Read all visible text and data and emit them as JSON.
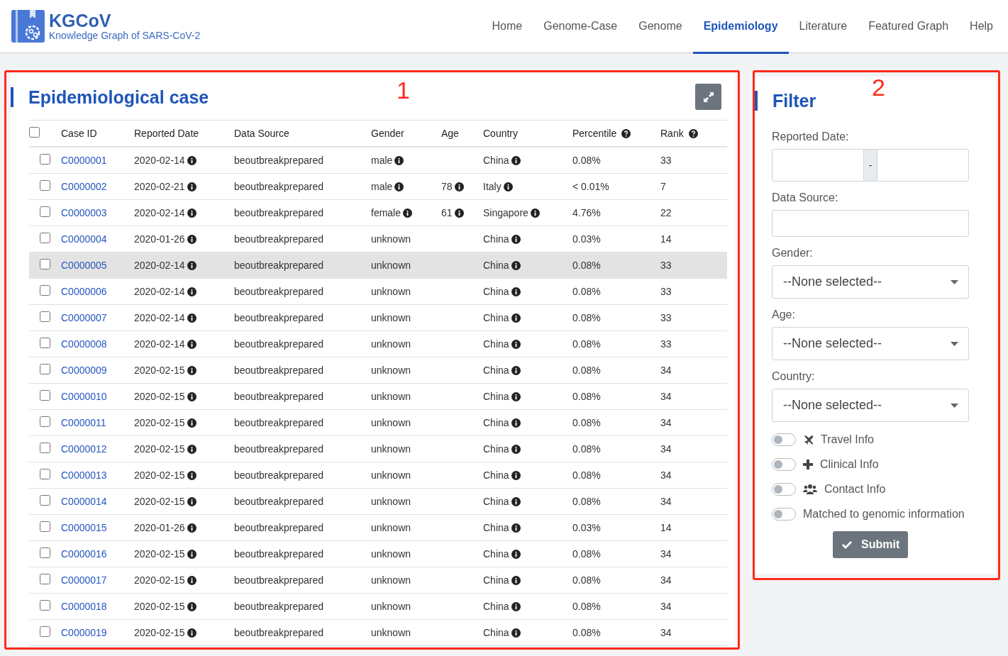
{
  "brand": {
    "name": "KGCoV",
    "subtitle": "Knowledge Graph of SARS-CoV-2"
  },
  "nav": [
    {
      "label": "Home",
      "selected": false
    },
    {
      "label": "Genome-Case",
      "selected": false
    },
    {
      "label": "Genome",
      "selected": false
    },
    {
      "label": "Epidemiology",
      "selected": true
    },
    {
      "label": "Literature",
      "selected": false
    },
    {
      "label": "Featured Graph",
      "selected": false
    },
    {
      "label": "Help",
      "selected": false
    }
  ],
  "case_panel": {
    "title": "Epidemiological case",
    "annotation": "1",
    "columns": [
      {
        "label": "Case ID",
        "help": false
      },
      {
        "label": "Reported Date",
        "help": false
      },
      {
        "label": "Data Source",
        "help": false
      },
      {
        "label": "Gender",
        "help": false
      },
      {
        "label": "Age",
        "help": false
      },
      {
        "label": "Country",
        "help": false
      },
      {
        "label": "Percentile",
        "help": true
      },
      {
        "label": "Rank",
        "help": true
      }
    ],
    "select_all": false,
    "rows": [
      {
        "id": "C0000001",
        "date": "2020-02-14",
        "source": "beoutbreakprepared",
        "gender": "male",
        "gender_info": true,
        "age": "",
        "country": "China",
        "percentile": "0.08%",
        "rank": "33",
        "checked": false,
        "highlighted": false
      },
      {
        "id": "C0000002",
        "date": "2020-02-21",
        "source": "beoutbreakprepared",
        "gender": "male",
        "gender_info": true,
        "age": "78",
        "country": "Italy",
        "percentile": "< 0.01%",
        "rank": "7",
        "checked": false,
        "highlighted": false
      },
      {
        "id": "C0000003",
        "date": "2020-02-14",
        "source": "beoutbreakprepared",
        "gender": "female",
        "gender_info": true,
        "age": "61",
        "country": "Singapore",
        "percentile": "4.76%",
        "rank": "22",
        "checked": false,
        "highlighted": false
      },
      {
        "id": "C0000004",
        "date": "2020-01-26",
        "source": "beoutbreakprepared",
        "gender": "unknown",
        "gender_info": false,
        "age": "",
        "country": "China",
        "percentile": "0.03%",
        "rank": "14",
        "checked": false,
        "highlighted": false
      },
      {
        "id": "C0000005",
        "date": "2020-02-14",
        "source": "beoutbreakprepared",
        "gender": "unknown",
        "gender_info": false,
        "age": "",
        "country": "China",
        "percentile": "0.08%",
        "rank": "33",
        "checked": false,
        "highlighted": true
      },
      {
        "id": "C0000006",
        "date": "2020-02-14",
        "source": "beoutbreakprepared",
        "gender": "unknown",
        "gender_info": false,
        "age": "",
        "country": "China",
        "percentile": "0.08%",
        "rank": "33",
        "checked": false,
        "highlighted": false
      },
      {
        "id": "C0000007",
        "date": "2020-02-14",
        "source": "beoutbreakprepared",
        "gender": "unknown",
        "gender_info": false,
        "age": "",
        "country": "China",
        "percentile": "0.08%",
        "rank": "33",
        "checked": false,
        "highlighted": false
      },
      {
        "id": "C0000008",
        "date": "2020-02-14",
        "source": "beoutbreakprepared",
        "gender": "unknown",
        "gender_info": false,
        "age": "",
        "country": "China",
        "percentile": "0.08%",
        "rank": "33",
        "checked": false,
        "highlighted": false
      },
      {
        "id": "C0000009",
        "date": "2020-02-15",
        "source": "beoutbreakprepared",
        "gender": "unknown",
        "gender_info": false,
        "age": "",
        "country": "China",
        "percentile": "0.08%",
        "rank": "34",
        "checked": false,
        "highlighted": false
      },
      {
        "id": "C0000010",
        "date": "2020-02-15",
        "source": "beoutbreakprepared",
        "gender": "unknown",
        "gender_info": false,
        "age": "",
        "country": "China",
        "percentile": "0.08%",
        "rank": "34",
        "checked": false,
        "highlighted": false
      },
      {
        "id": "C0000011",
        "date": "2020-02-15",
        "source": "beoutbreakprepared",
        "gender": "unknown",
        "gender_info": false,
        "age": "",
        "country": "China",
        "percentile": "0.08%",
        "rank": "34",
        "checked": false,
        "highlighted": false
      },
      {
        "id": "C0000012",
        "date": "2020-02-15",
        "source": "beoutbreakprepared",
        "gender": "unknown",
        "gender_info": false,
        "age": "",
        "country": "China",
        "percentile": "0.08%",
        "rank": "34",
        "checked": false,
        "highlighted": false
      },
      {
        "id": "C0000013",
        "date": "2020-02-15",
        "source": "beoutbreakprepared",
        "gender": "unknown",
        "gender_info": false,
        "age": "",
        "country": "China",
        "percentile": "0.08%",
        "rank": "34",
        "checked": false,
        "highlighted": false
      },
      {
        "id": "C0000014",
        "date": "2020-02-15",
        "source": "beoutbreakprepared",
        "gender": "unknown",
        "gender_info": false,
        "age": "",
        "country": "China",
        "percentile": "0.08%",
        "rank": "34",
        "checked": false,
        "highlighted": false
      },
      {
        "id": "C0000015",
        "date": "2020-01-26",
        "source": "beoutbreakprepared",
        "gender": "unknown",
        "gender_info": false,
        "age": "",
        "country": "China",
        "percentile": "0.03%",
        "rank": "14",
        "checked": false,
        "highlighted": false
      },
      {
        "id": "C0000016",
        "date": "2020-02-15",
        "source": "beoutbreakprepared",
        "gender": "unknown",
        "gender_info": false,
        "age": "",
        "country": "China",
        "percentile": "0.08%",
        "rank": "34",
        "checked": false,
        "highlighted": false
      },
      {
        "id": "C0000017",
        "date": "2020-02-15",
        "source": "beoutbreakprepared",
        "gender": "unknown",
        "gender_info": false,
        "age": "",
        "country": "China",
        "percentile": "0.08%",
        "rank": "34",
        "checked": false,
        "highlighted": false
      },
      {
        "id": "C0000018",
        "date": "2020-02-15",
        "source": "beoutbreakprepared",
        "gender": "unknown",
        "gender_info": false,
        "age": "",
        "country": "China",
        "percentile": "0.08%",
        "rank": "34",
        "checked": false,
        "highlighted": false
      },
      {
        "id": "C0000019",
        "date": "2020-02-15",
        "source": "beoutbreakprepared",
        "gender": "unknown",
        "gender_info": false,
        "age": "",
        "country": "China",
        "percentile": "0.08%",
        "rank": "34",
        "checked": false,
        "highlighted": false
      }
    ]
  },
  "filter": {
    "title": "Filter",
    "annotation": "2",
    "date_label": "Reported Date:",
    "date_separator": "-",
    "source_label": "Data Source:",
    "selects": [
      {
        "label": "Gender:",
        "value": "--None selected--"
      },
      {
        "label": "Age:",
        "value": "--None selected--"
      },
      {
        "label": "Country:",
        "value": "--None selected--"
      }
    ],
    "toggles": [
      {
        "kind": "plane",
        "label": "Travel Info",
        "on": false
      },
      {
        "kind": "plus",
        "label": "Clinical Info",
        "on": false
      },
      {
        "kind": "people",
        "label": "Contact Info",
        "on": false
      },
      {
        "kind": "plain",
        "label": "Matched to genomic information",
        "on": false
      }
    ],
    "submit": "Submit"
  }
}
